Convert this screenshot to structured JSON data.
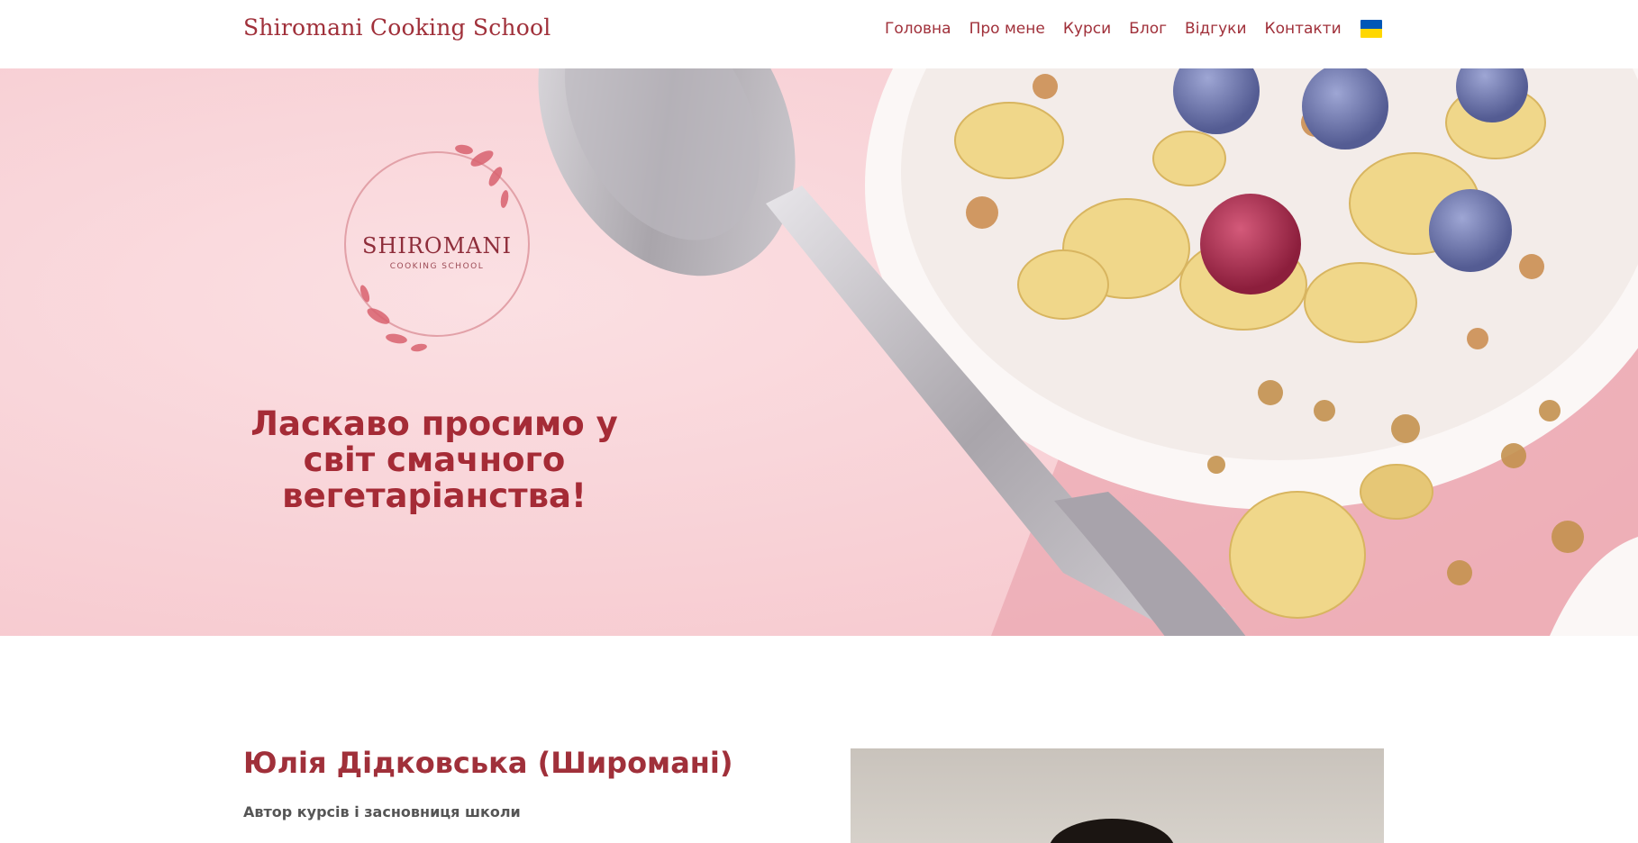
{
  "header": {
    "brand": "Shiromani Cooking School",
    "nav": [
      {
        "label": "Головна"
      },
      {
        "label": "Про мене"
      },
      {
        "label": "Курси"
      },
      {
        "label": "Блог"
      },
      {
        "label": "Відгуки"
      },
      {
        "label": "Контакти"
      }
    ],
    "language_flag": {
      "icon": "ukraine-flag-icon",
      "colors": [
        "#0057b7",
        "#ffd700"
      ]
    }
  },
  "hero": {
    "logo_text": "SHIROMANI",
    "logo_subtext": "COOKING SCHOOL",
    "title": "Ласкаво просимо у світ смачного вегетаріанства!"
  },
  "author": {
    "name": "Юлія Дідковська (Широмані)",
    "role": "Автор курсів і засновниця школи"
  },
  "colors": {
    "accent": "#a0303a",
    "hero_background": "#f9d4d8"
  }
}
